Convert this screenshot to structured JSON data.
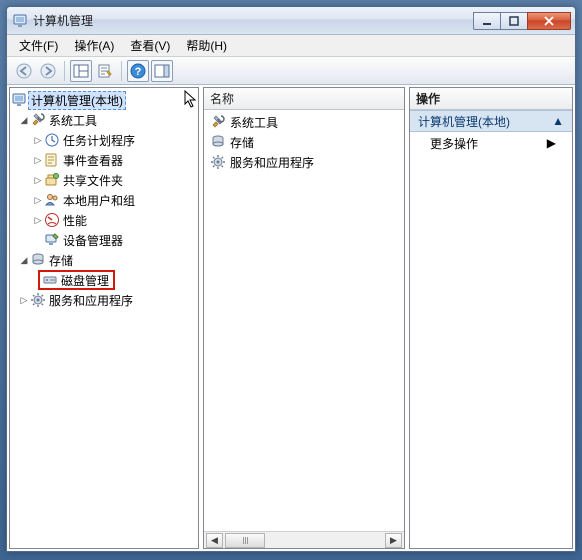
{
  "window": {
    "title": "计算机管理"
  },
  "menu": {
    "file": "文件(F)",
    "action": "操作(A)",
    "view": "查看(V)",
    "help": "帮助(H)"
  },
  "left": {
    "root": "计算机管理(本地)",
    "systools": "系统工具",
    "scheduler": "任务计划程序",
    "eventviewer": "事件查看器",
    "shared": "共享文件夹",
    "users": "本地用户和组",
    "perf": "性能",
    "device": "设备管理器",
    "storage": "存储",
    "diskmgmt": "磁盘管理",
    "services": "服务和应用程序"
  },
  "middle": {
    "header": "名称",
    "systools": "系统工具",
    "storage": "存储",
    "services": "服务和应用程序"
  },
  "right": {
    "header": "操作",
    "group": "计算机管理(本地)",
    "more": "更多操作"
  }
}
